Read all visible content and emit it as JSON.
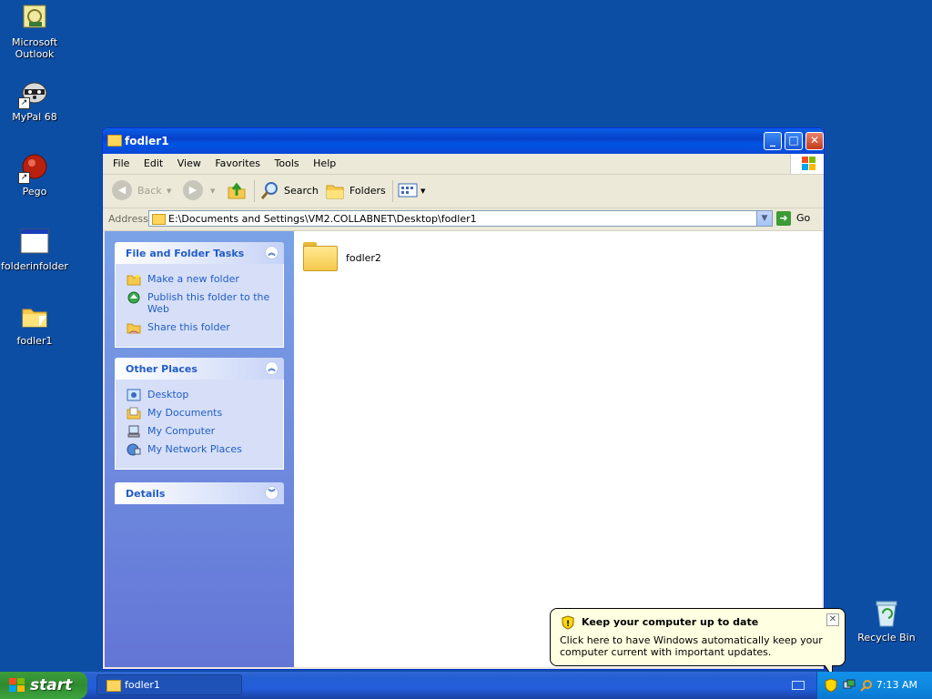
{
  "desktop": {
    "icons": [
      {
        "label": "Microsoft Outlook"
      },
      {
        "label": "MyPal 68"
      },
      {
        "label": "Pego"
      },
      {
        "label": "folderinfolder"
      },
      {
        "label": "fodler1"
      },
      {
        "label": "Recycle Bin"
      }
    ]
  },
  "window": {
    "title": "fodler1",
    "menu": [
      "File",
      "Edit",
      "View",
      "Favorites",
      "Tools",
      "Help"
    ],
    "toolbar": {
      "back": "Back",
      "search": "Search",
      "folders": "Folders"
    },
    "address": {
      "label": "Address",
      "value": "E:\\Documents and Settings\\VM2.COLLABNET\\Desktop\\fodler1",
      "go": "Go"
    },
    "taskpane": {
      "file_tasks": {
        "title": "File and Folder Tasks",
        "items": [
          "Make a new folder",
          "Publish this folder to the Web",
          "Share this folder"
        ]
      },
      "other_places": {
        "title": "Other Places",
        "items": [
          "Desktop",
          "My Documents",
          "My Computer",
          "My Network Places"
        ]
      },
      "details": {
        "title": "Details"
      }
    },
    "files": [
      {
        "name": "fodler2"
      }
    ]
  },
  "balloon": {
    "title": "Keep your computer up to date",
    "body": "Click here to have Windows automatically keep your computer current with important updates."
  },
  "taskbar": {
    "start": "start",
    "task_button": "fodler1",
    "clock": "7:13 AM"
  },
  "colors": {
    "desktop": "#0d4ea5",
    "taskbar": "#245edb",
    "start_button": "#3c9d3c",
    "taskpane_link": "#215dc6"
  }
}
